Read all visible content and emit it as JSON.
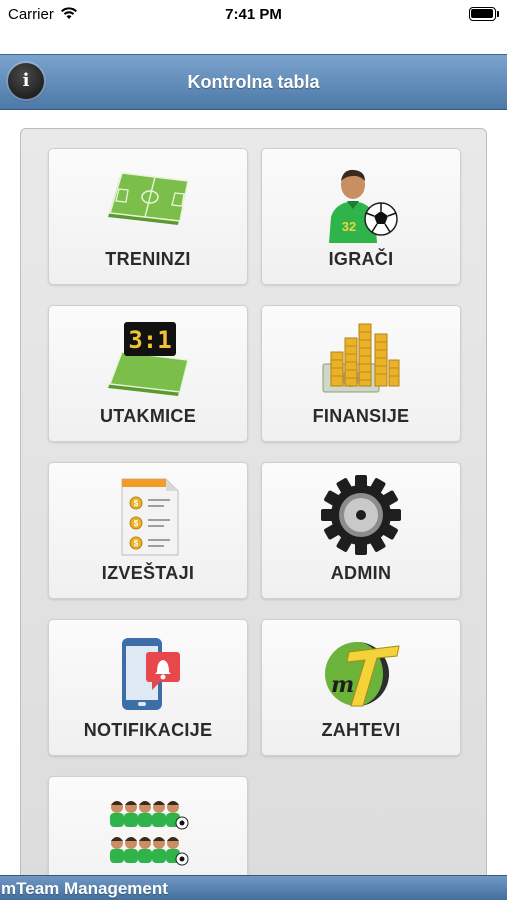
{
  "status_bar": {
    "carrier": "Carrier",
    "time": "7:41 PM",
    "wifi_icon": "wifi-icon",
    "battery_icon": "battery-icon"
  },
  "header": {
    "title": "Kontrolna tabla",
    "info_icon": "i"
  },
  "tiles": [
    {
      "label": "TRENINZI",
      "icon": "training-field-icon"
    },
    {
      "label": "IGRAČI",
      "icon": "player-icon"
    },
    {
      "label": "UTAKMICE",
      "icon": "scoreboard-icon"
    },
    {
      "label": "FINANSIJE",
      "icon": "coins-icon"
    },
    {
      "label": "IZVEŠTAJI",
      "icon": "report-icon"
    },
    {
      "label": "ADMIN",
      "icon": "gear-icon"
    },
    {
      "label": "NOTIFIKACIJE",
      "icon": "phone-notification-icon"
    },
    {
      "label": "ZAHTEVI",
      "icon": "mteam-logo-icon"
    },
    {
      "label": "",
      "icon": "team-icon"
    }
  ],
  "scoreboard": {
    "score": "3:1"
  },
  "player_number": "32",
  "footer": {
    "text": "mTeam Management"
  },
  "colors": {
    "header_blue": "#5d89b8",
    "field_green": "#7bbf4a",
    "jersey_green": "#2fb34b",
    "coin_gold": "#e9b227",
    "bell_red": "#e8474b"
  }
}
